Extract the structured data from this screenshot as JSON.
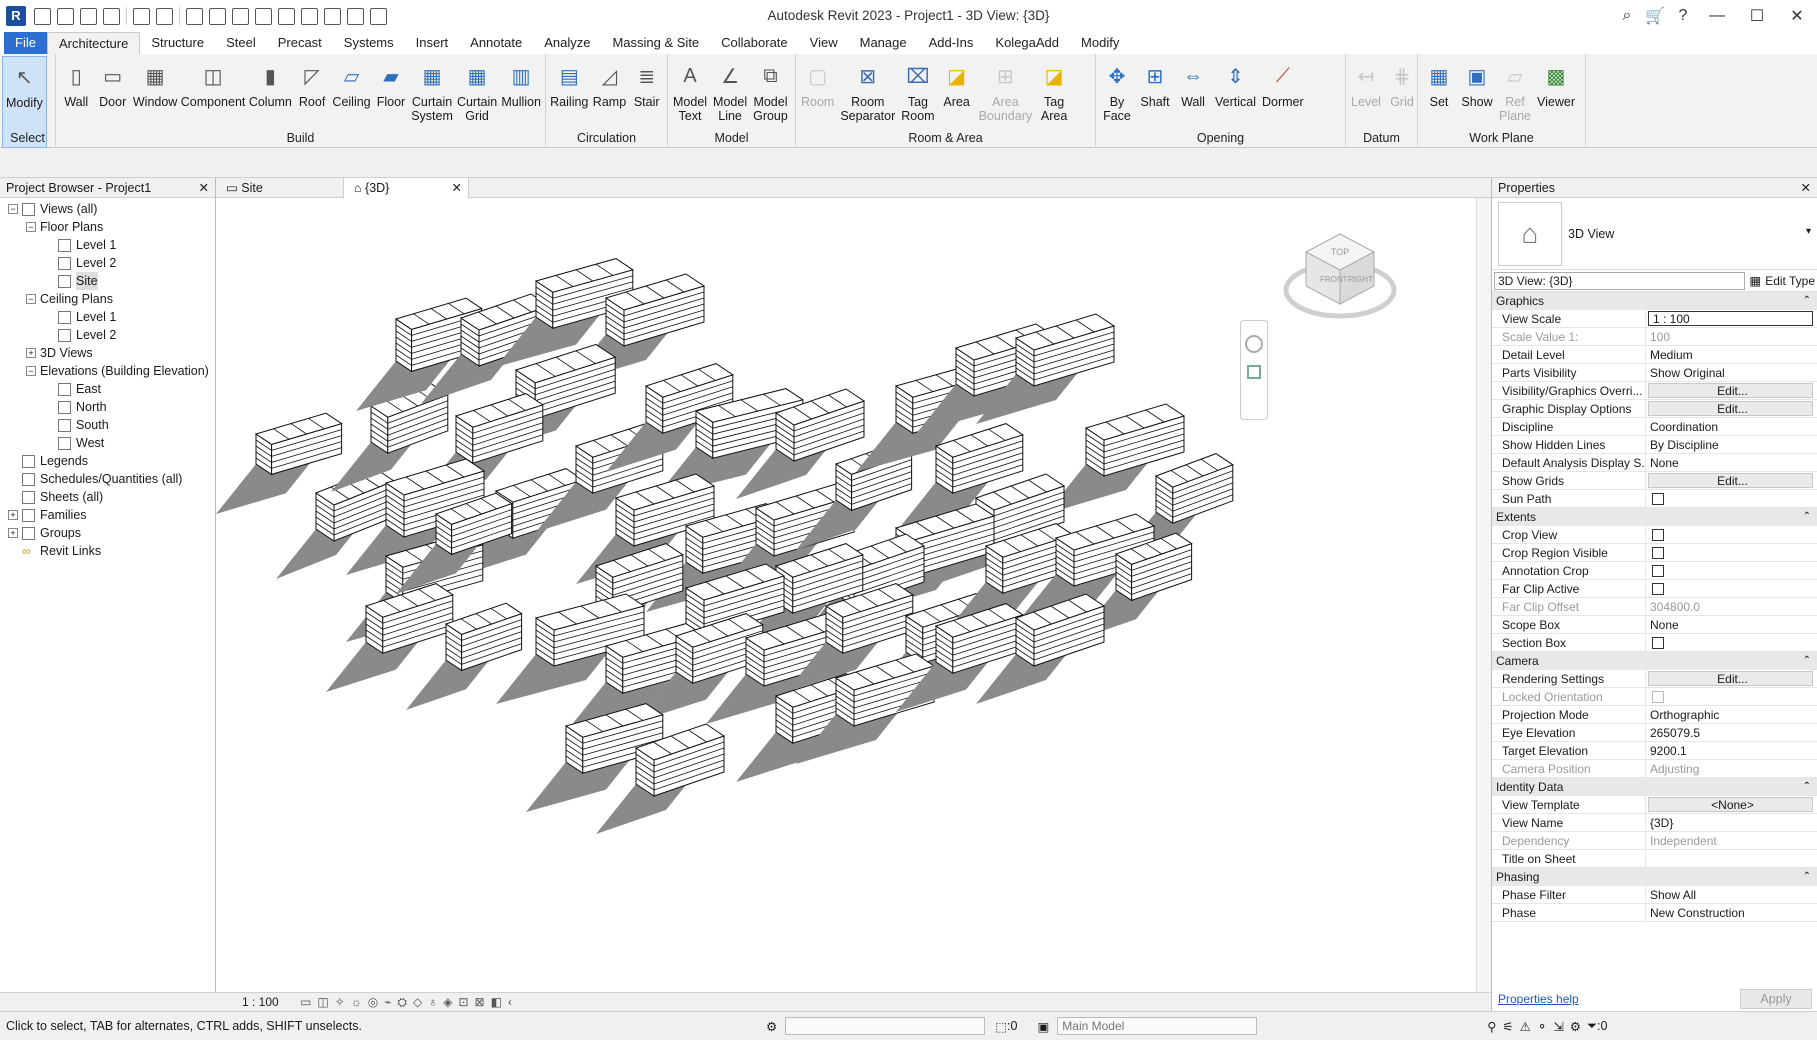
{
  "app": {
    "title": "Autodesk Revit 2023 - Project1 - 3D View: {3D}",
    "icon_letter": "R"
  },
  "tabs": [
    "File",
    "Architecture",
    "Structure",
    "Steel",
    "Precast",
    "Systems",
    "Insert",
    "Annotate",
    "Analyze",
    "Massing & Site",
    "Collaborate",
    "View",
    "Manage",
    "Add-Ins",
    "KolegaAdd",
    "Modify"
  ],
  "ribbon": {
    "select": {
      "title": "Select",
      "buttons": [
        {
          "label": "Modify",
          "icon": "cursor-icon"
        }
      ]
    },
    "build": {
      "title": "Build",
      "buttons": [
        {
          "label": "Wall",
          "icon": "wall-icon"
        },
        {
          "label": "Door",
          "icon": "door-icon"
        },
        {
          "label": "Window",
          "icon": "window-icon"
        },
        {
          "label": "Component",
          "icon": "component-icon"
        },
        {
          "label": "Column",
          "icon": "column-icon"
        },
        {
          "label": "Roof",
          "icon": "roof-icon"
        },
        {
          "label": "Ceiling",
          "icon": "ceiling-icon"
        },
        {
          "label": "Floor",
          "icon": "floor-icon"
        },
        {
          "label": "Curtain\nSystem",
          "icon": "curtain-system-icon"
        },
        {
          "label": "Curtain\nGrid",
          "icon": "curtain-grid-icon"
        },
        {
          "label": "Mullion",
          "icon": "mullion-icon"
        }
      ]
    },
    "circulation": {
      "title": "Circulation",
      "buttons": [
        {
          "label": "Railing",
          "icon": "railing-icon"
        },
        {
          "label": "Ramp",
          "icon": "ramp-icon"
        },
        {
          "label": "Stair",
          "icon": "stair-icon"
        }
      ]
    },
    "model": {
      "title": "Model",
      "buttons": [
        {
          "label": "Model\nText",
          "icon": "model-text-icon"
        },
        {
          "label": "Model\nLine",
          "icon": "model-line-icon"
        },
        {
          "label": "Model\nGroup",
          "icon": "model-group-icon"
        }
      ]
    },
    "room": {
      "title": "Room & Area",
      "buttons": [
        {
          "label": "Room",
          "icon": "room-icon",
          "dim": true
        },
        {
          "label": "Room\nSeparator",
          "icon": "room-separator-icon"
        },
        {
          "label": "Tag\nRoom",
          "icon": "tag-room-icon"
        },
        {
          "label": "Area",
          "icon": "area-icon"
        },
        {
          "label": "Area\nBoundary",
          "icon": "area-boundary-icon",
          "dim": true
        },
        {
          "label": "Tag\nArea",
          "icon": "tag-area-icon"
        }
      ]
    },
    "opening": {
      "title": "Opening",
      "buttons": [
        {
          "label": "By\nFace",
          "icon": "by-face-icon"
        },
        {
          "label": "Shaft",
          "icon": "shaft-icon"
        },
        {
          "label": "Wall",
          "icon": "wall-opening-icon"
        },
        {
          "label": "Vertical",
          "icon": "vertical-icon"
        },
        {
          "label": "Dormer",
          "icon": "dormer-icon"
        }
      ]
    },
    "datum": {
      "title": "Datum",
      "buttons": [
        {
          "label": "Level",
          "icon": "level-icon",
          "dim": true
        },
        {
          "label": "Grid",
          "icon": "grid-icon",
          "dim": true
        }
      ]
    },
    "workplane": {
      "title": "Work Plane",
      "buttons": [
        {
          "label": "Set",
          "icon": "set-icon"
        },
        {
          "label": "Show",
          "icon": "show-icon"
        },
        {
          "label": "Ref\nPlane",
          "icon": "ref-plane-icon",
          "dim": true
        },
        {
          "label": "Viewer",
          "icon": "viewer-icon"
        }
      ]
    }
  },
  "project_browser": {
    "title": "Project Browser - Project1",
    "items": [
      {
        "label": "Views (all)",
        "depth": 0,
        "toggle": "-",
        "icon": "views"
      },
      {
        "label": "Floor Plans",
        "depth": 1,
        "toggle": "-"
      },
      {
        "label": "Level 1",
        "depth": 2,
        "icon": "view"
      },
      {
        "label": "Level 2",
        "depth": 2,
        "icon": "view"
      },
      {
        "label": "Site",
        "depth": 2,
        "icon": "view",
        "highlight": true
      },
      {
        "label": "Ceiling Plans",
        "depth": 1,
        "toggle": "-"
      },
      {
        "label": "Level 1",
        "depth": 2,
        "icon": "view"
      },
      {
        "label": "Level 2",
        "depth": 2,
        "icon": "view"
      },
      {
        "label": "3D Views",
        "depth": 1,
        "toggle": "+"
      },
      {
        "label": "Elevations (Building Elevation)",
        "depth": 1,
        "toggle": "-"
      },
      {
        "label": "East",
        "depth": 2,
        "icon": "view"
      },
      {
        "label": "North",
        "depth": 2,
        "icon": "view"
      },
      {
        "label": "South",
        "depth": 2,
        "icon": "view"
      },
      {
        "label": "West",
        "depth": 2,
        "icon": "view"
      },
      {
        "label": "Legends",
        "depth": 0,
        "icon": "legend"
      },
      {
        "label": "Schedules/Quantities (all)",
        "depth": 0,
        "icon": "schedule"
      },
      {
        "label": "Sheets (all)",
        "depth": 0,
        "icon": "sheet"
      },
      {
        "label": "Families",
        "depth": 0,
        "toggle": "+",
        "icon": "family"
      },
      {
        "label": "Groups",
        "depth": 0,
        "toggle": "+",
        "icon": "group"
      },
      {
        "label": "Revit Links",
        "depth": 0,
        "icon": "link"
      }
    ]
  },
  "view_tabs": [
    {
      "label": "Site",
      "active": false
    },
    {
      "label": "{3D}",
      "active": true
    }
  ],
  "view_control": {
    "scale": "1 : 100"
  },
  "viewcube": {
    "top": "TOP",
    "front": "FRONT",
    "right": "RIGHT"
  },
  "properties": {
    "title": "Properties",
    "type_name": "3D View",
    "instance_selector": "3D View: {3D}",
    "edit_type": "Edit Type",
    "groups": [
      {
        "name": "Graphics",
        "rows": [
          {
            "k": "View Scale",
            "v": "1 : 100",
            "style": "boxed"
          },
          {
            "k": "Scale Value    1:",
            "v": "100",
            "dis": true
          },
          {
            "k": "Detail Level",
            "v": "Medium"
          },
          {
            "k": "Parts Visibility",
            "v": "Show Original"
          },
          {
            "k": "Visibility/Graphics Overri...",
            "v": "Edit...",
            "style": "btn"
          },
          {
            "k": "Graphic Display Options",
            "v": "Edit...",
            "style": "btn"
          },
          {
            "k": "Discipline",
            "v": "Coordination"
          },
          {
            "k": "Show Hidden Lines",
            "v": "By Discipline"
          },
          {
            "k": "Default Analysis Display S...",
            "v": "None"
          },
          {
            "k": "Show Grids",
            "v": "Edit...",
            "style": "btn"
          },
          {
            "k": "Sun Path",
            "v": "",
            "style": "check"
          }
        ]
      },
      {
        "name": "Extents",
        "rows": [
          {
            "k": "Crop View",
            "v": "",
            "style": "check"
          },
          {
            "k": "Crop Region Visible",
            "v": "",
            "style": "check"
          },
          {
            "k": "Annotation Crop",
            "v": "",
            "style": "check"
          },
          {
            "k": "Far Clip Active",
            "v": "",
            "style": "check"
          },
          {
            "k": "Far Clip Offset",
            "v": "304800.0",
            "dis": true
          },
          {
            "k": "Scope Box",
            "v": "None"
          },
          {
            "k": "Section Box",
            "v": "",
            "style": "check"
          }
        ]
      },
      {
        "name": "Camera",
        "rows": [
          {
            "k": "Rendering Settings",
            "v": "Edit...",
            "style": "btn"
          },
          {
            "k": "Locked Orientation",
            "v": "",
            "style": "check",
            "dis": true
          },
          {
            "k": "Projection Mode",
            "v": "Orthographic"
          },
          {
            "k": "Eye Elevation",
            "v": "265079.5"
          },
          {
            "k": "Target Elevation",
            "v": "9200.1"
          },
          {
            "k": "Camera Position",
            "v": "Adjusting",
            "dis": true
          }
        ]
      },
      {
        "name": "Identity Data",
        "rows": [
          {
            "k": "View Template",
            "v": "<None>",
            "style": "btn"
          },
          {
            "k": "View Name",
            "v": "{3D}"
          },
          {
            "k": "Dependency",
            "v": "Independent",
            "dis": true
          },
          {
            "k": "Title on Sheet",
            "v": ""
          }
        ]
      },
      {
        "name": "Phasing",
        "rows": [
          {
            "k": "Phase Filter",
            "v": "Show All"
          },
          {
            "k": "Phase",
            "v": "New Construction"
          }
        ]
      }
    ],
    "help": "Properties help",
    "apply": "Apply"
  },
  "status": {
    "hint": "Click to select, TAB for alternates, CTRL adds, SHIFT unselects.",
    "selection_count": ":0",
    "model": "Main Model",
    "filter_count": ":0"
  }
}
